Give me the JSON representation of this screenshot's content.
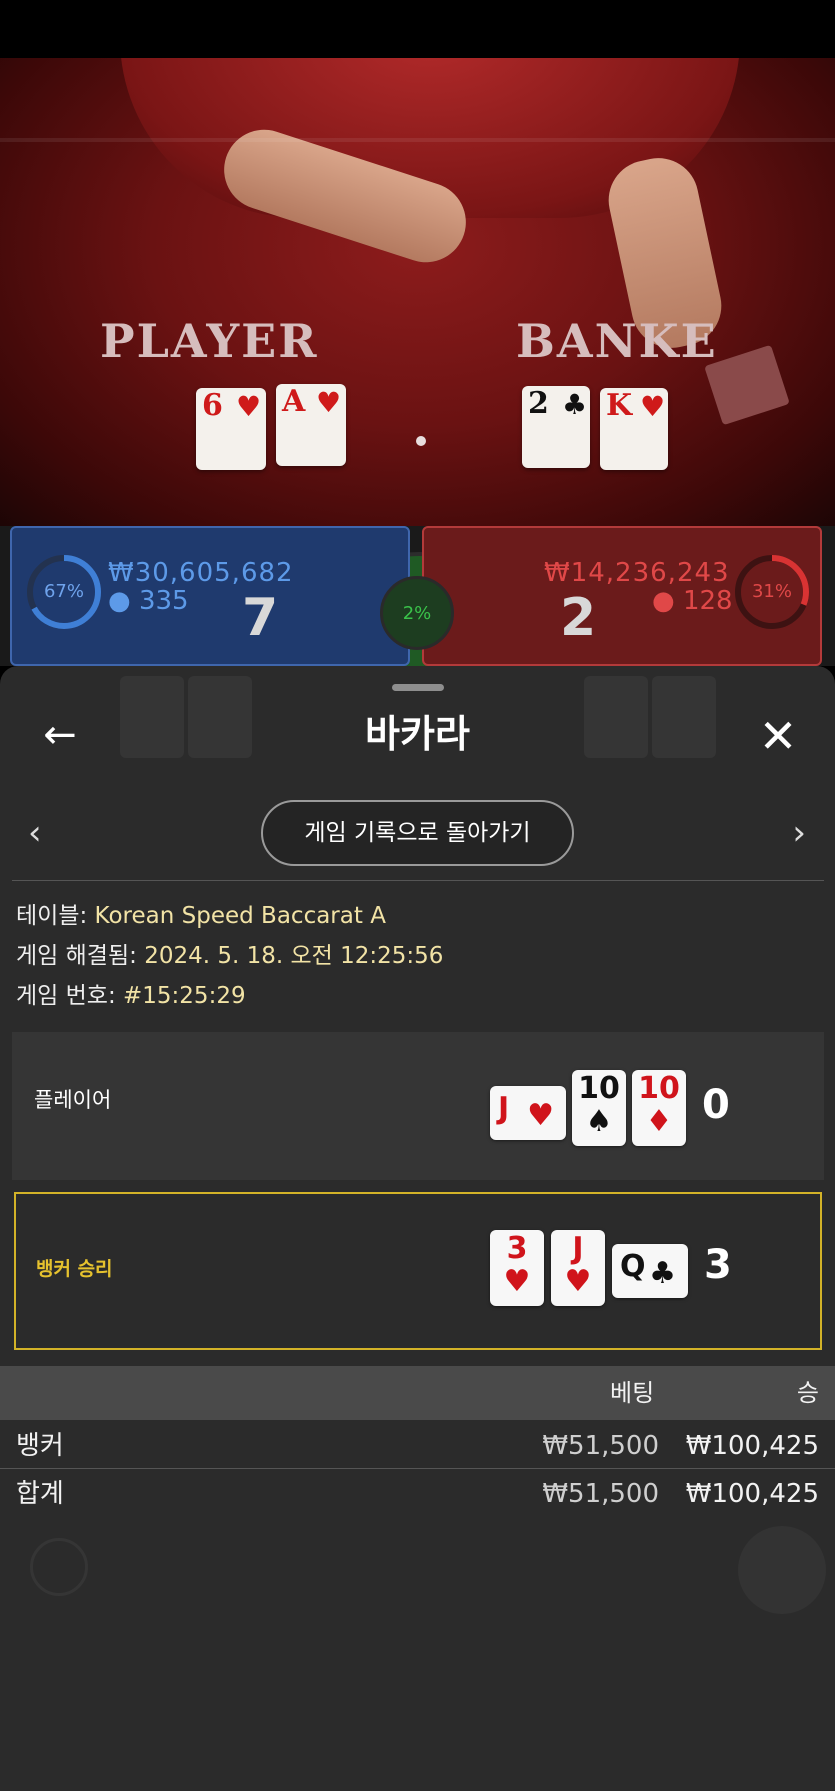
{
  "video": {
    "label_player": "PLAYER",
    "label_banker": "BANKE",
    "player_cards": [
      {
        "rank": "6",
        "suit": "♥"
      },
      {
        "rank": "A",
        "suit": "♥"
      }
    ],
    "banker_cards": [
      {
        "rank": "2",
        "suit": "♣"
      },
      {
        "rank": "K",
        "suit": "♥"
      }
    ]
  },
  "bet_strip": {
    "player": {
      "percent": "67%",
      "amount": "₩30,605,682",
      "players": "335",
      "total": "7",
      "fill": 0.67
    },
    "banker": {
      "percent": "31%",
      "amount": "₩14,236,243",
      "players": "128",
      "total": "2",
      "fill": 0.31
    },
    "tie": {
      "percent": "2%"
    }
  },
  "sheet": {
    "back_icon": "←",
    "title": "바카라",
    "close_icon": "✕",
    "prev_icon": "‹",
    "next_icon": "›",
    "history_button": "게임 기록으로 돌아가기",
    "table_label": "테이블:",
    "table_value": "Korean Speed Baccarat A",
    "resolved_label": "게임 해결됨:",
    "resolved_value": "2024. 5. 18. 오전 12:25:56",
    "round_label": "게임 번호:",
    "round_value": "#15:25:29",
    "player_row": {
      "label": "플레이어",
      "cards": [
        {
          "rank": "J",
          "suit": "♥",
          "color": "red"
        },
        {
          "rank": "10",
          "suit": "♠",
          "color": "black"
        },
        {
          "rank": "10",
          "suit": "♦",
          "color": "red"
        }
      ],
      "score": "0"
    },
    "banker_row": {
      "label": "뱅커 승리",
      "cards": [
        {
          "rank": "3",
          "suit": "♥",
          "color": "red"
        },
        {
          "rank": "J",
          "suit": "♥",
          "color": "red"
        },
        {
          "rank": "Q",
          "suit": "♣",
          "color": "black"
        }
      ],
      "score": "3"
    },
    "bets": {
      "header_bet": "베팅",
      "header_win": "승",
      "rows": [
        {
          "name": "뱅커",
          "bet": "₩51,500",
          "win": "₩100,425"
        },
        {
          "name": "합계",
          "bet": "₩51,500",
          "win": "₩100,425"
        }
      ]
    }
  },
  "colors": {
    "highlight": "#d3b328",
    "player_blue": "#3f7fd6",
    "banker_red": "#d93333",
    "tie_green": "#3ac24a"
  }
}
